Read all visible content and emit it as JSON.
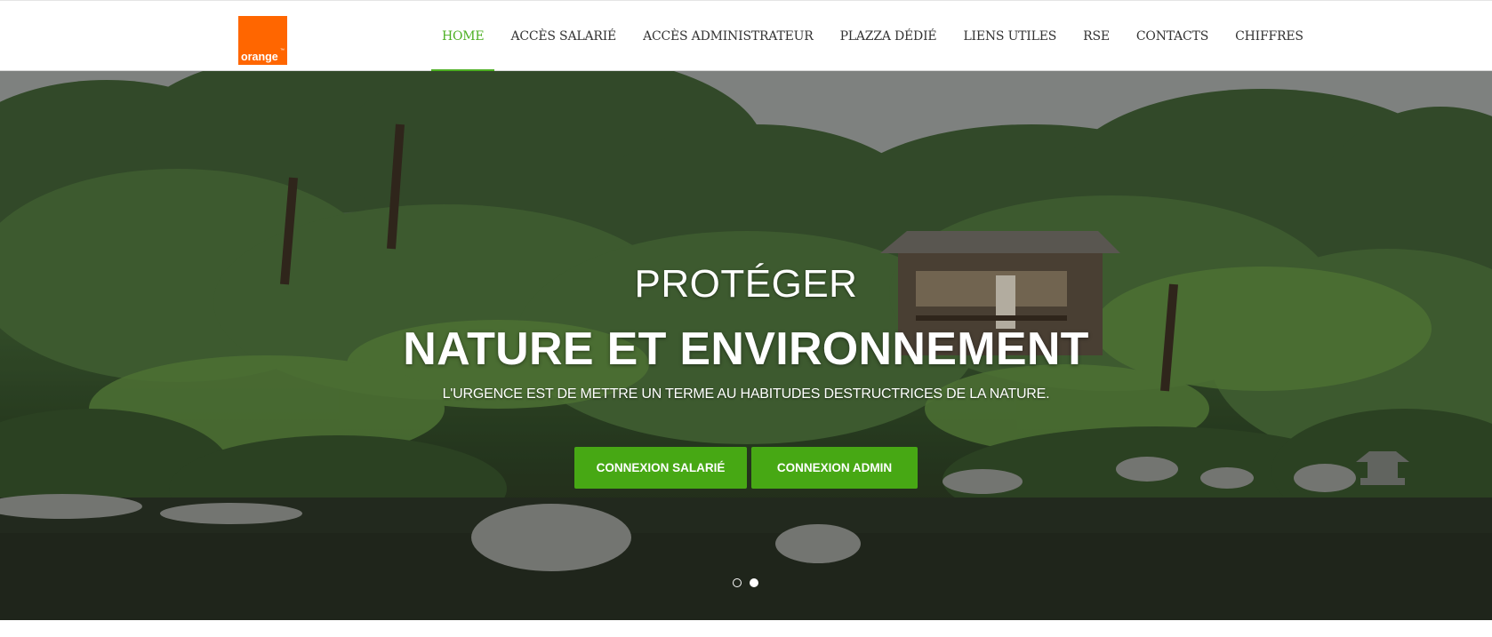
{
  "brand": {
    "logo_text": "orange",
    "logo_mark": "™",
    "color": "#ff6600"
  },
  "nav": {
    "items": [
      {
        "label": "HOME",
        "active": true
      },
      {
        "label": "ACCÈS SALARIÉ",
        "active": false
      },
      {
        "label": "ACCÈS ADMINISTRATEUR",
        "active": false
      },
      {
        "label": "PLAZZA DÉDIÉ",
        "active": false
      },
      {
        "label": "LIENS UTILES",
        "active": false
      },
      {
        "label": "RSE",
        "active": false
      },
      {
        "label": "CONTACTS",
        "active": false
      },
      {
        "label": "CHIFFRES",
        "active": false
      }
    ],
    "active_color": "#4caf22"
  },
  "hero": {
    "kicker": "PROTÉGER",
    "title": "NATURE ET ENVIRONNEMENT",
    "subtitle": "L'URGENCE EST DE METTRE UN TERME AU HABITUDES DESTRUCTRICES DE LA NATURE.",
    "buttons": {
      "salarie": "CONNEXION SALARIÉ",
      "admin": "CONNEXION ADMIN"
    },
    "button_color": "#47a814",
    "slides": {
      "count": 2,
      "active_index": 1
    }
  }
}
